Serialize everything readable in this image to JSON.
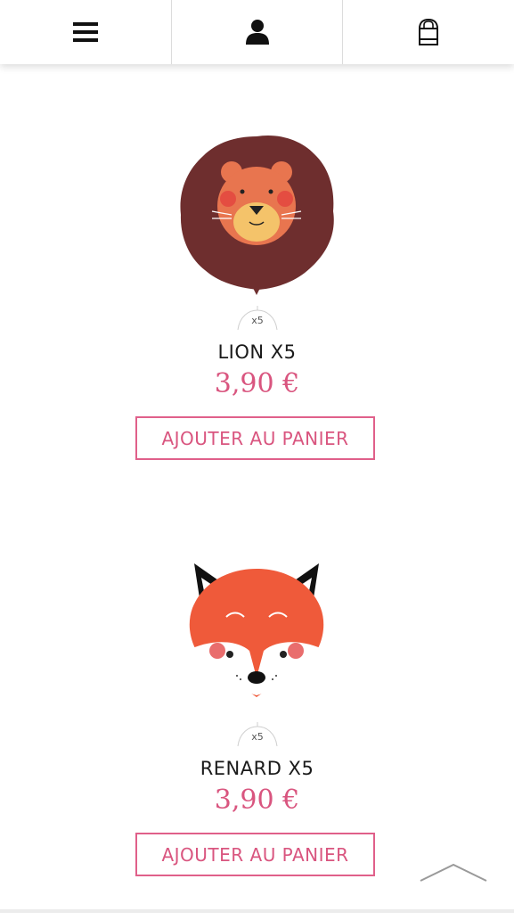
{
  "nav": {
    "menu_icon": "hamburger-menu-icon",
    "account_icon": "user-icon",
    "cart_icon": "shopping-bag-icon"
  },
  "products": [
    {
      "name": "LION X5",
      "price": "3,90 €",
      "quantity_badge": "x5",
      "add_to_cart_label": "AJOUTER AU PANIER",
      "image": "lion-face-illustration"
    },
    {
      "name": "RENARD X5",
      "price": "3,90 €",
      "quantity_badge": "x5",
      "add_to_cart_label": "AJOUTER AU PANIER",
      "image": "fox-face-illustration"
    }
  ],
  "colors": {
    "accent_pink": "#d9557f",
    "button_border": "#e0608a",
    "lion_mane": "#6e2e2e",
    "fox_orange": "#ef5a3a"
  },
  "scroll_top_icon": "chevron-up-icon"
}
